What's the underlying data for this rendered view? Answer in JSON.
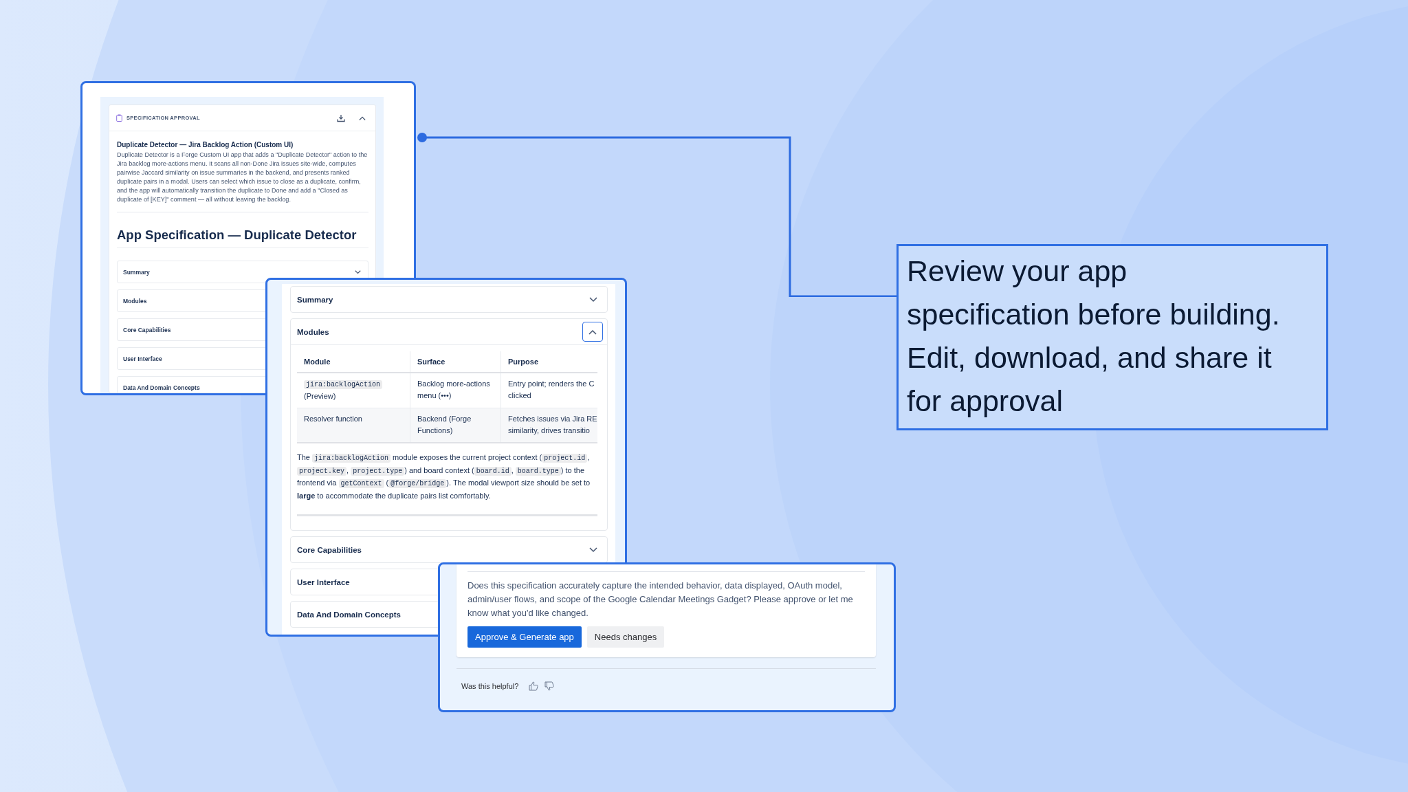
{
  "spec_panel": {
    "header": {
      "title": "SPECIFICATION APPROVAL"
    },
    "app_title": "Duplicate Detector — Jira Backlog Action (Custom UI)",
    "description": "Duplicate Detector is a Forge Custom UI app that adds a \"Duplicate Detector\" action to the Jira backlog more-actions menu. It scans all non-Done Jira issues site-wide, computes pairwise Jaccard similarity on issue summaries in the backend, and presents ranked duplicate pairs in a modal. Users can select which issue to close as a duplicate, confirm, and the app will automatically transition the duplicate to Done and add a \"Closed as duplicate of [KEY]\" comment — all without leaving the backlog.",
    "heading": "App Specification — Duplicate Detector",
    "sections": [
      {
        "label": "Summary",
        "expanded": false
      },
      {
        "label": "Modules"
      },
      {
        "label": "Core Capabilities"
      },
      {
        "label": "User Interface"
      },
      {
        "label": "Data And Domain Concepts"
      }
    ]
  },
  "modules_panel": {
    "sections": [
      {
        "label": "Summary",
        "expanded": false
      },
      {
        "label": "Modules",
        "expanded": true,
        "table": {
          "columns": [
            "Module",
            "Surface",
            "Purpose"
          ],
          "rows": [
            [
              {
                "code": "jira:backlogAction",
                "text": "(Preview)"
              },
              {
                "text": "Backlog more-actions\nmenu (•••)"
              },
              {
                "text": "Entry point; renders the C\nclicked"
              }
            ],
            [
              {
                "text": "Resolver function"
              },
              {
                "text": "Backend (Forge\nFunctions)"
              },
              {
                "text": "Fetches issues via Jira RE\nsimilarity, drives transitio"
              }
            ]
          ]
        },
        "paragraph": [
          {
            "kind": "text",
            "text": "The "
          },
          {
            "kind": "code",
            "text": "jira:backlogAction"
          },
          {
            "kind": "text",
            "text": " module exposes the current project context ("
          },
          {
            "kind": "code",
            "text": "project.id"
          },
          {
            "kind": "text",
            "text": ", "
          },
          {
            "kind": "code",
            "text": "project.key"
          },
          {
            "kind": "text",
            "text": ", "
          },
          {
            "kind": "code",
            "text": "project.type"
          },
          {
            "kind": "text",
            "text": ") and board context ("
          },
          {
            "kind": "code",
            "text": "board.id"
          },
          {
            "kind": "text",
            "text": ", "
          },
          {
            "kind": "code",
            "text": "board.type"
          },
          {
            "kind": "text",
            "text": ") to the frontend via "
          },
          {
            "kind": "code",
            "text": "getContext"
          },
          {
            "kind": "text",
            "text": " ("
          },
          {
            "kind": "code",
            "text": "@forge/bridge"
          },
          {
            "kind": "text",
            "text": "). The modal viewport size should be set to "
          },
          {
            "kind": "bold",
            "text": "large"
          },
          {
            "kind": "text",
            "text": " to accommodate the duplicate pairs list comfortably."
          }
        ]
      },
      {
        "label": "Core Capabilities",
        "expanded": false
      },
      {
        "label": "User Interface"
      },
      {
        "label": "Data And Domain Concepts"
      }
    ]
  },
  "approval_panel": {
    "question": "Does this specification accurately capture the intended behavior, data displayed, OAuth model, admin/user flows, and scope of the Google Calendar Meetings Gadget? Please approve or let me know what you'd like changed.",
    "buttons": [
      {
        "label": "Approve & Generate app",
        "kind": "primary"
      },
      {
        "label": "Needs changes",
        "kind": "secondary"
      }
    ],
    "feedback": {
      "label": "Was this helpful?"
    }
  },
  "callout": {
    "text": "Review your app\nspecification before building.\nEdit, download, and share it\nfor approval"
  }
}
